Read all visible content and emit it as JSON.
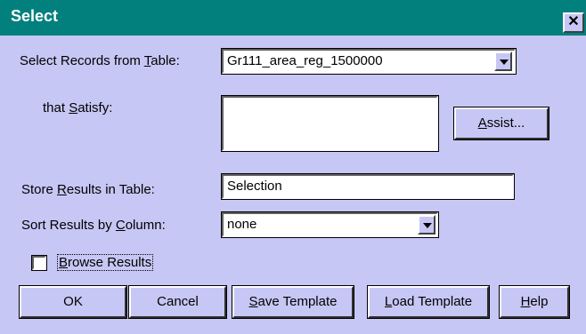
{
  "window": {
    "title": "Select",
    "close_glyph": "✕"
  },
  "select_records": {
    "label_pre": "Select Records from ",
    "label_key": "T",
    "label_post": "able:",
    "value": "Gr111_area_reg_1500000"
  },
  "satisfy": {
    "label_pre": "that ",
    "label_key": "S",
    "label_post": "atisfy:",
    "value": ""
  },
  "assist_button": {
    "key": "A",
    "rest": "ssist..."
  },
  "store_results": {
    "label_pre": "Store ",
    "label_key": "R",
    "label_post": "esults in Table:",
    "value": "Selection"
  },
  "sort_results": {
    "label_pre": "Sort Results by ",
    "label_key": "C",
    "label_post": "olumn:",
    "value": "none"
  },
  "browse_results": {
    "key": "B",
    "rest": "rowse Results",
    "checked": false
  },
  "buttons": {
    "ok": "OK",
    "cancel": "Cancel",
    "save_template": {
      "key": "S",
      "rest": "ave Template"
    },
    "load_template": {
      "key": "L",
      "rest": "oad Template"
    },
    "help": {
      "key": "H",
      "rest": "elp"
    }
  }
}
